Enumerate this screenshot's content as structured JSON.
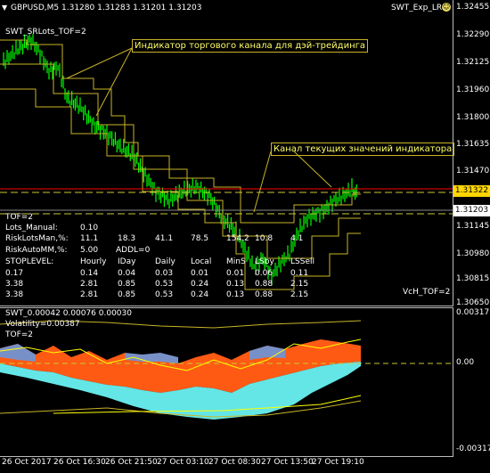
{
  "header": {
    "symbol_title": "GBPUSD,M5  1.31280 1.31283 1.31201 1.31203",
    "expert_name": "SWT_Exp_LRE",
    "indicator_name": "SWT_SRLots_TOF=2"
  },
  "icons": {
    "expert": "smiley-face-icon",
    "chart_menu": "triangle-menu-icon"
  },
  "callouts": {
    "channel_indicator": "Индикатор торгового канала для дэй-трейдинга",
    "current_values": "Канал текущих значений индикатора"
  },
  "price_axis": [
    "1.32455",
    "1.32290",
    "1.32125",
    "1.31960",
    "1.31800",
    "1.31635",
    "1.31470",
    "1.31322",
    "1.31203",
    "1.31145",
    "1.30980",
    "1.30815",
    "1.30650"
  ],
  "price_boxes": {
    "upper": "1.31322",
    "current": "1.31203"
  },
  "info_panel": {
    "tof": "TOF=2",
    "lots_manual_label": "Lots_Manual:",
    "lots_manual_value": "0.10",
    "risk_lots_label": "RiskLotsMan,%:",
    "risk_lots_values": [
      "11.1",
      "18.3",
      "41.1",
      "78.5",
      "154.2",
      "10.8",
      "4.1"
    ],
    "risk_auto_label": "RiskAutoMM,%:",
    "risk_auto_value": "5.00",
    "addl": "ADDL=0",
    "columns": [
      "STOPLEVEL:",
      "Hourly",
      "IDay",
      "Daily",
      "Local",
      "MinS",
      "LSby",
      "LSSell"
    ],
    "rows": [
      [
        "0.17",
        "0.14",
        "0.04",
        "0.03",
        "0.01",
        "0.01",
        "0.06",
        "0.11"
      ],
      [
        "3.38",
        "2.81",
        "0.85",
        "0.53",
        "0.24",
        "0.13",
        "0.88",
        "2.15"
      ],
      [
        "3.38",
        "2.81",
        "0.85",
        "0.53",
        "0.24",
        "0.13",
        "0.88",
        "2.15"
      ]
    ],
    "vch": "VcH_TOF=2"
  },
  "sub_window": {
    "title": "SWT_0.00042 0.00076 0.00030",
    "volatility": "Volatility=0.00387",
    "tof": "TOF=2",
    "axis": [
      "0.00317",
      "0.00",
      "-0.00317"
    ]
  },
  "time_axis": [
    "26 Oct 2017",
    "26 Oct 16:30",
    "26 Oct 21:50",
    "27 Oct 03:10",
    "27 Oct 08:30",
    "27 Oct 13:50",
    "27 Oct 19:10"
  ],
  "colors": {
    "candle": "#00ff00",
    "channel": "#c8b428",
    "upper_line": "#ff0000",
    "orange": "#ff5a14",
    "cyan": "#64e6e6",
    "blue": "#7890c8"
  }
}
